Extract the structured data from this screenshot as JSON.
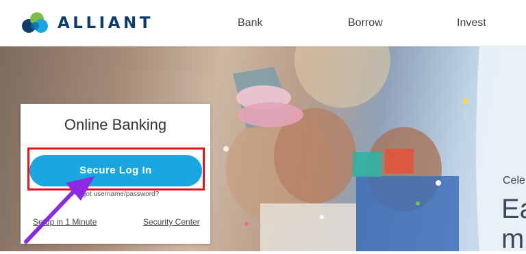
{
  "header": {
    "brand": "ALLIANT",
    "nav": [
      {
        "label": "Bank"
      },
      {
        "label": "Borrow"
      },
      {
        "label": "Invest"
      }
    ]
  },
  "login_card": {
    "title": "Online Banking",
    "login_button": "Secure Log In",
    "forgot_text": "Forgot username/password?",
    "setup_link": "Setup in 1 Minute",
    "security_link": "Security Center"
  },
  "hero": {
    "subtitle": "Cele",
    "title_line1": "Ea",
    "title_line2": "m"
  },
  "colors": {
    "brand_navy": "#0f3c6d",
    "button_blue": "#1aa7e0",
    "highlight_red": "#e0121a",
    "arrow_purple": "#8a2be2"
  }
}
